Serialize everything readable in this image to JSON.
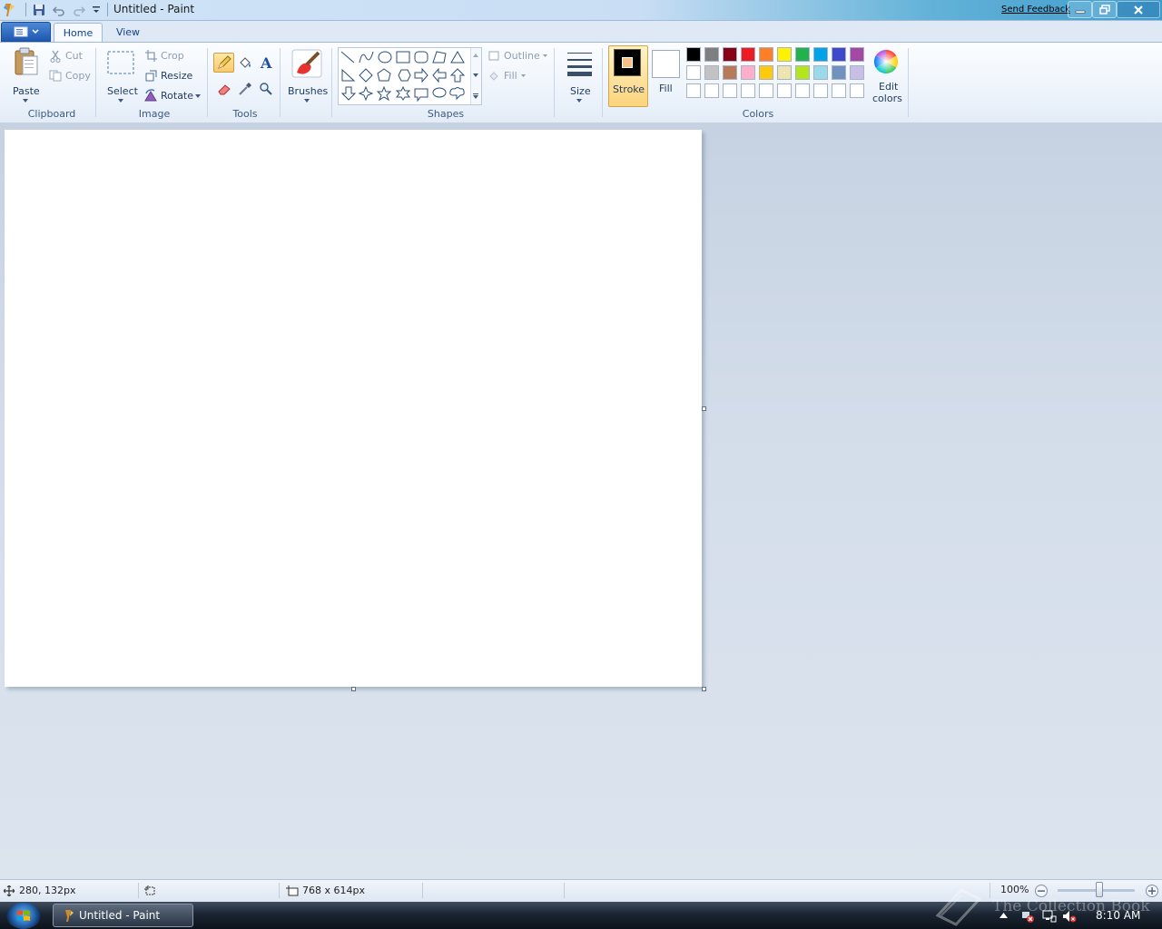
{
  "window": {
    "title": "Untitled - Paint",
    "feedback_link": "Send Feedback"
  },
  "tabs": [
    {
      "label": "Home",
      "active": true
    },
    {
      "label": "View",
      "active": false
    }
  ],
  "clipboard": {
    "paste": "Paste",
    "cut": "Cut",
    "copy": "Copy",
    "group_label": "Clipboard"
  },
  "image": {
    "select": "Select",
    "crop": "Crop",
    "resize": "Resize",
    "rotate": "Rotate",
    "group_label": "Image"
  },
  "tools": {
    "group_label": "Tools",
    "items": [
      "pencil-icon",
      "fill-bucket-icon",
      "text-icon",
      "eraser-icon",
      "color-picker-icon",
      "magnifier-icon"
    ],
    "selected": "pencil-icon"
  },
  "brushes": {
    "label": "Brushes"
  },
  "shapes": {
    "group_label": "Shapes",
    "outline": "Outline",
    "fill": "Fill",
    "items": [
      "line",
      "curve",
      "oval",
      "rectangle",
      "rounded-rectangle",
      "polygon",
      "triangle",
      "right-triangle",
      "diamond",
      "pentagon",
      "hexagon",
      "right-arrow",
      "left-arrow",
      "up-arrow",
      "down-arrow",
      "four-point-star",
      "five-point-star",
      "six-point-star",
      "rounded-callout",
      "oval-callout",
      "cloud-callout"
    ]
  },
  "size": {
    "label": "Size"
  },
  "colors": {
    "group_label": "Colors",
    "stroke_label": "Stroke",
    "fill_label": "Fill",
    "edit_colors_line1": "Edit",
    "edit_colors_line2": "colors",
    "stroke_color": "#000000",
    "fill_color": "#ffffff",
    "palette_row1": [
      "#000000",
      "#7f7f7f",
      "#880015",
      "#ed1c24",
      "#ff7f27",
      "#fff200",
      "#22b14c",
      "#00a2e8",
      "#3f48cc",
      "#a349a4"
    ],
    "palette_row2": [
      "#ffffff",
      "#c3c3c3",
      "#b97a57",
      "#ffaec9",
      "#ffc90e",
      "#efe4b0",
      "#b5e61d",
      "#99d9ea",
      "#7092be",
      "#c8bfe7"
    ],
    "palette_row3": [
      "#ffffff",
      "#ffffff",
      "#ffffff",
      "#ffffff",
      "#ffffff",
      "#ffffff",
      "#ffffff",
      "#ffffff",
      "#ffffff",
      "#ffffff"
    ]
  },
  "status": {
    "cursor_position": "280, 132px",
    "canvas_size": "768 x 614px",
    "zoom": "100%"
  },
  "taskbar": {
    "task_label": "Untitled - Paint",
    "clock": "8:10 AM",
    "watermark": "The Collection Book"
  }
}
